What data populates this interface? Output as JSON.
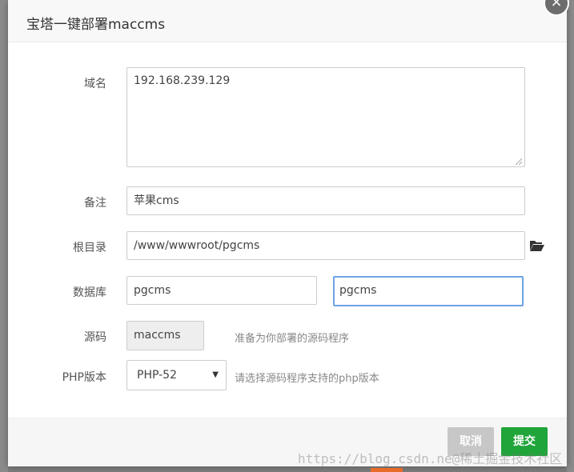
{
  "dialog": {
    "title": "宝塔一键部署maccms",
    "close_glyph": "×"
  },
  "form": {
    "domain_label": "域名",
    "domain_value": "192.168.239.129",
    "remark_label": "备注",
    "remark_value": "苹果cms",
    "root_label": "根目录",
    "root_value": "/www/wwwroot/pgcms",
    "db_label": "数据库",
    "db_name_value": "pgcms",
    "db_password_value": "pgcms",
    "source_label": "源码",
    "source_value": "maccms",
    "source_hint": "准备为你部署的源码程序",
    "php_label": "PHP版本",
    "php_selected": "PHP-52",
    "php_hint": "请选择源码程序支持的php版本"
  },
  "footer": {
    "cancel_label": "取消",
    "submit_label": "提交"
  },
  "watermark": "https://blog.csdn.ne@稀土掘金技术社区",
  "colors": {
    "primary": "#20a53a",
    "focus_border": "#6fa3e4",
    "cancel": "#c7c7c7"
  }
}
